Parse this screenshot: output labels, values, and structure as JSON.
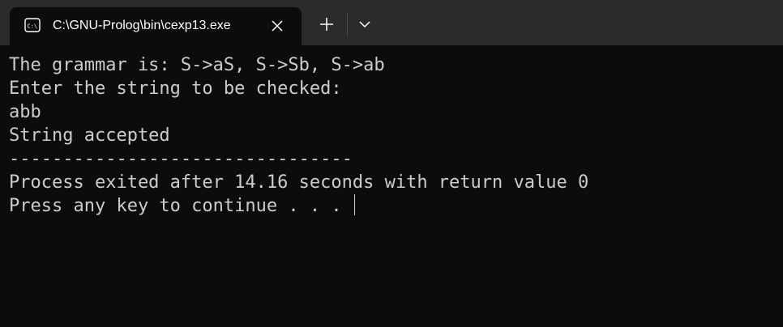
{
  "window": {
    "tab_title": "C:\\GNU-Prolog\\bin\\cexp13.exe",
    "tab_icon": "console-icon",
    "close_icon": "close-icon",
    "new_tab_icon": "plus-icon",
    "dropdown_icon": "chevron-down-icon"
  },
  "terminal": {
    "lines": [
      "The grammar is: S->aS, S->Sb, S->ab",
      "Enter the string to be checked:",
      "abb",
      "String accepted",
      "--------------------------------",
      "Process exited after 14.16 seconds with return value 0",
      "Press any key to continue . . . "
    ]
  },
  "colors": {
    "titlebar": "#2b2b2b",
    "background": "#0c0c0c",
    "text": "#cccccc"
  }
}
